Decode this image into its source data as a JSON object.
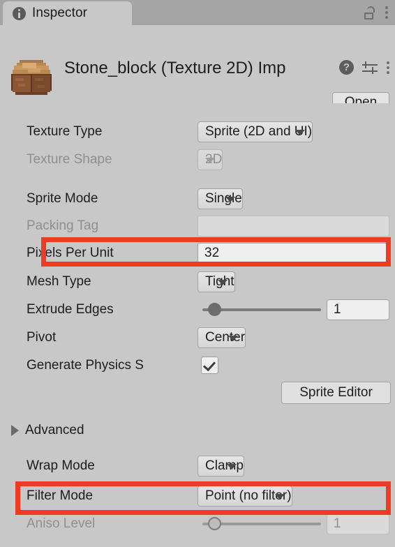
{
  "window": {
    "tab": {
      "label": "Inspector",
      "icon": "info-icon"
    },
    "lock_icon": "unlocked-padlock-icon",
    "menu_icon": "kebab-menu-icon"
  },
  "header": {
    "thumbnail": "stone-block-sprite-thumbnail",
    "title": "Stone_block (Texture 2D) Imp",
    "help_icon": "help-icon",
    "preset_icon": "preset-settings-icon",
    "menu_icon": "kebab-menu-icon",
    "open_button": "Open"
  },
  "properties": [
    {
      "name": "texture-type",
      "label": "Texture Type",
      "control": "dropdown",
      "value": "Sprite (2D and UI)",
      "disabled": false
    },
    {
      "name": "texture-shape",
      "label": "Texture Shape",
      "control": "dropdown",
      "value": "2D",
      "disabled": true
    },
    {
      "name": "sprite-mode",
      "label": "Sprite Mode",
      "control": "dropdown",
      "value": "Single",
      "disabled": false
    },
    {
      "name": "packing-tag",
      "label": "Packing Tag",
      "control": "text",
      "value": "",
      "disabled": true
    },
    {
      "name": "pixels-per-unit",
      "label": "Pixels Per Unit",
      "control": "text",
      "value": "32",
      "disabled": false,
      "highlighted": true
    },
    {
      "name": "mesh-type",
      "label": "Mesh Type",
      "control": "dropdown",
      "value": "Tight",
      "disabled": false
    },
    {
      "name": "extrude-edges",
      "label": "Extrude Edges",
      "control": "slider",
      "value": "1",
      "disabled": false
    },
    {
      "name": "pivot",
      "label": "Pivot",
      "control": "dropdown",
      "value": "Center",
      "disabled": false
    },
    {
      "name": "generate-physics-shape",
      "label": "Generate Physics S",
      "control": "checkbox",
      "value": "checked",
      "disabled": false
    }
  ],
  "sprite_editor_button": "Sprite Editor",
  "advanced": {
    "label": "Advanced",
    "expanded": false,
    "foldout_icon": "triangle-right-icon"
  },
  "advanced_properties": [
    {
      "name": "wrap-mode",
      "label": "Wrap Mode",
      "control": "dropdown",
      "value": "Clamp",
      "disabled": false
    },
    {
      "name": "filter-mode",
      "label": "Filter Mode",
      "control": "dropdown",
      "value": "Point (no filter)",
      "disabled": false,
      "highlighted": true
    },
    {
      "name": "aniso-level",
      "label": "Aniso Level",
      "control": "slider",
      "value": "1",
      "disabled": true
    }
  ],
  "colors": {
    "highlight": "#ef3b21",
    "panel_bg": "#c8c8c8",
    "tabstrip_bg": "#a5a5a5"
  }
}
